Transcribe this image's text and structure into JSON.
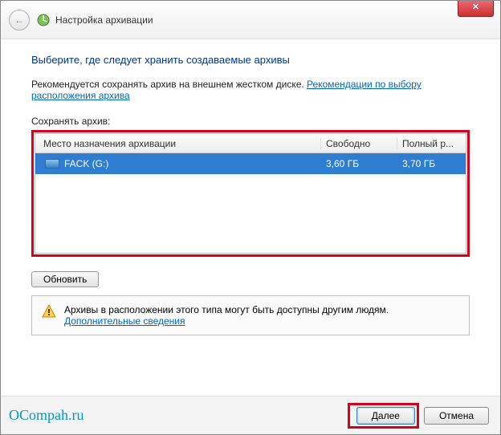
{
  "window": {
    "close_glyph": "✕",
    "back_glyph": "←",
    "title": "Настройка архивации"
  },
  "page": {
    "heading": "Выберите, где следует хранить создаваемые архивы",
    "desc_prefix": "Рекомендуется сохранять архив на внешнем жестком диске. ",
    "rec_link": "Рекомендации по выбору расположения архива",
    "save_label": "Сохранять архив:"
  },
  "columns": {
    "dest": "Место назначения архивации",
    "free": "Свободно",
    "total": "Полный р..."
  },
  "row": {
    "name": "FACK (G:)",
    "free": "3,60 ГБ",
    "total": "3,70 ГБ"
  },
  "refresh": "Обновить",
  "warning": {
    "text": "Архивы в расположении этого типа могут быть доступны другим людям.",
    "link": "Дополнительные сведения"
  },
  "footer": {
    "watermark": "OCompah.ru",
    "next": "Далее",
    "cancel": "Отмена"
  }
}
